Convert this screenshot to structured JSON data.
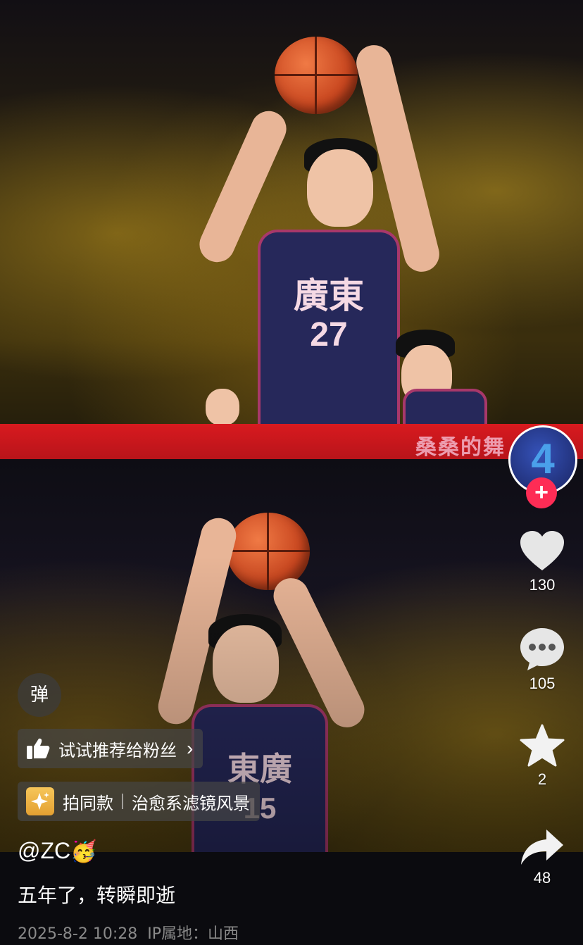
{
  "video": {
    "banner_text": "桑桑的舞",
    "top_jersey": {
      "team": "廣東",
      "number": "27"
    },
    "bottom_jersey": {
      "team": "東廣",
      "number": "15"
    }
  },
  "author": {
    "avatar_number": "4",
    "follow_icon": "plus-icon"
  },
  "actions": {
    "like_count": "130",
    "comment_count": "105",
    "favorite_count": "2",
    "share_count": "48"
  },
  "danmu_label": "弹",
  "recommend": {
    "label": "试试推荐给粉丝",
    "chevron": "›"
  },
  "template": {
    "label": "拍同款",
    "effect": "治愈系滤镜风景"
  },
  "post": {
    "username": "@ZC",
    "username_emoji": "🥳",
    "caption": "五年了，转瞬即逝",
    "date": "2025-8-2 10:28",
    "ip_label": "IP属地：山西"
  },
  "colors": {
    "follow": "#fe2c55",
    "banner": "#d81a1f"
  }
}
